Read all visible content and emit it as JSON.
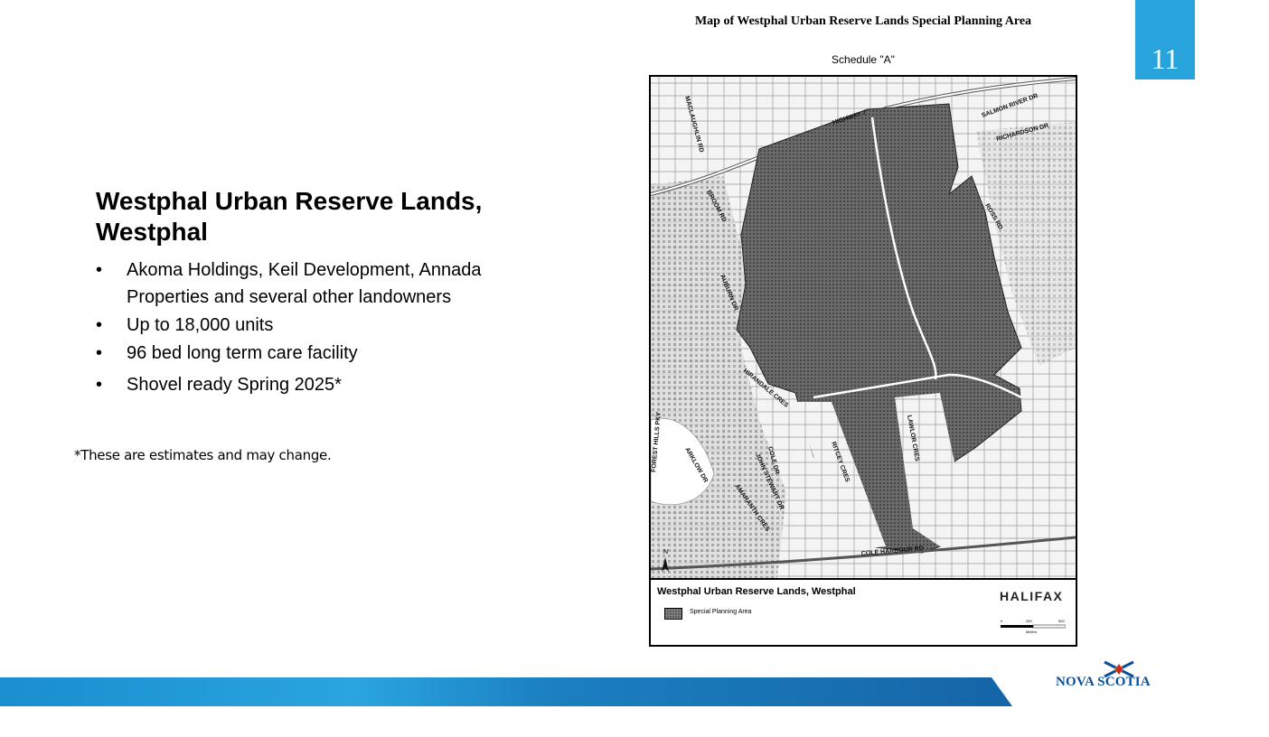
{
  "page_number": "11",
  "slide": {
    "title": "Westphal Urban Reserve Lands, Westphal",
    "bullets": [
      "Akoma Holdings, Keil Development, Annada Properties and several other landowners",
      "Up to 18,000 units",
      "96 bed long term care facility",
      "Shovel ready Spring 2025*"
    ],
    "bullet_symbol": "•",
    "footnote": "*These are estimates and may change."
  },
  "map": {
    "heading": "Map of Westphal Urban Reserve Lands Special Planning Area",
    "subheading": "Schedule \"A\"",
    "street_labels": [
      "HIGHWAY 7",
      "SALMON RIVER DR",
      "RICHARDSON DR",
      "MACLAUGHLIN RD",
      "BROOM RD",
      "ROSS RD",
      "AUBURN DR",
      "HIRANDALE CRES",
      "FOREST HILLS PKY",
      "ARKLOW DR",
      "COLE DR",
      "JOHN STEWART DR",
      "AMARANTH CRES",
      "RITCEY CRES",
      "LAWLOR CRES",
      "COLE HARBOUR RD"
    ],
    "north_label": "N",
    "legend_title": "Westphal Urban Reserve Lands, Westphal",
    "legend_item": "Special Planning Area",
    "logo_text": "HALIFAX",
    "scale": {
      "ticks": [
        "0",
        "250",
        "500"
      ],
      "unit": "Meters"
    }
  },
  "footer": {
    "logo_text": "NOVA SCOTIA"
  },
  "colors": {
    "badge": "#29a3dc",
    "planning_area": "#5a5a5a",
    "footer_blue": "#1a8ecf",
    "ns_blue": "#0b4f9c",
    "ns_gold": "#f2b21c"
  }
}
